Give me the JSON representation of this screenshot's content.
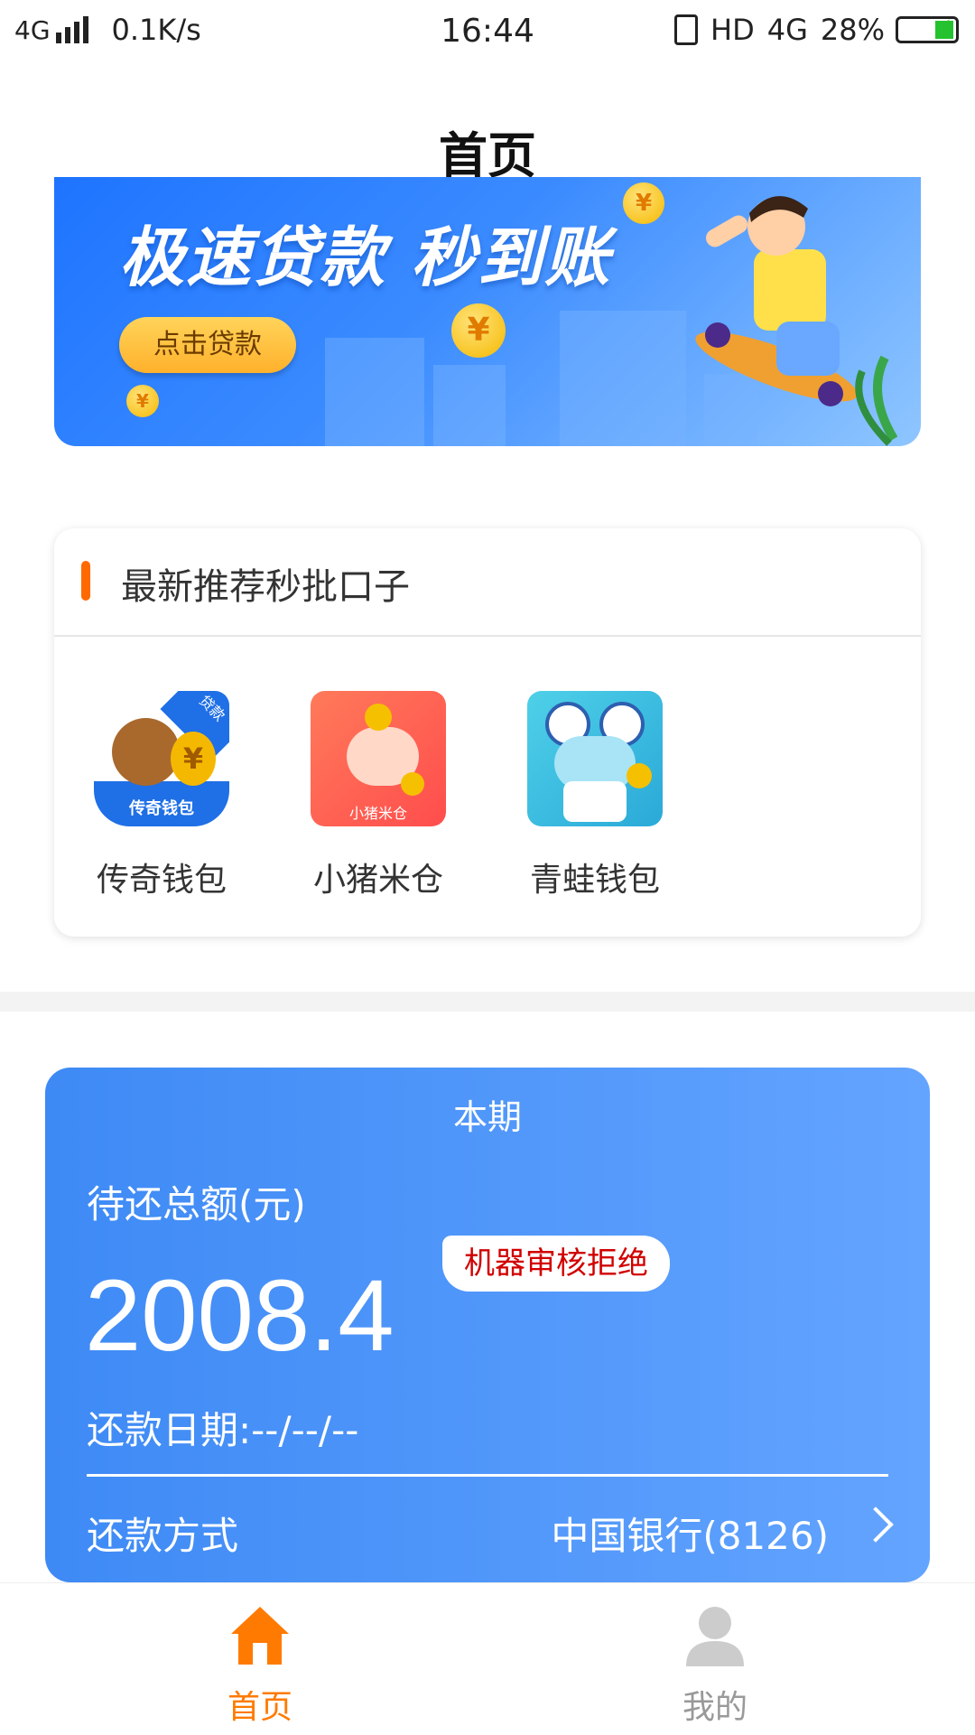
{
  "status_bar": {
    "network": "4G",
    "speed": "0.1K/s",
    "time": "16:44",
    "hd": "HD",
    "net_right": "4G",
    "battery": "28%"
  },
  "header": {
    "title": "首页"
  },
  "banner": {
    "headline": "极速贷款 秒到账",
    "button": "点击贷款"
  },
  "recommend": {
    "title": "最新推荐秒批口子",
    "apps": [
      {
        "name": "传奇钱包",
        "icon_text": "传奇钱包",
        "tag": "贷款"
      },
      {
        "name": "小猪米仓",
        "icon_text": "小猪米仓"
      },
      {
        "name": "青蛙钱包"
      }
    ]
  },
  "repayment": {
    "period": "本期",
    "label": "待还总额(元)",
    "amount": "2008.4",
    "badge": "机器审核拒绝",
    "date": "还款日期:--/--/--",
    "method_label": "还款方式",
    "bank": "中国银行(8126)"
  },
  "tabbar": {
    "tabs": [
      {
        "label": "首页",
        "active": true
      },
      {
        "label": "我的",
        "active": false
      }
    ]
  },
  "colors": {
    "accent": "#ff7a00",
    "card_blue": "#4a90f5",
    "badge_text": "#d10000"
  }
}
